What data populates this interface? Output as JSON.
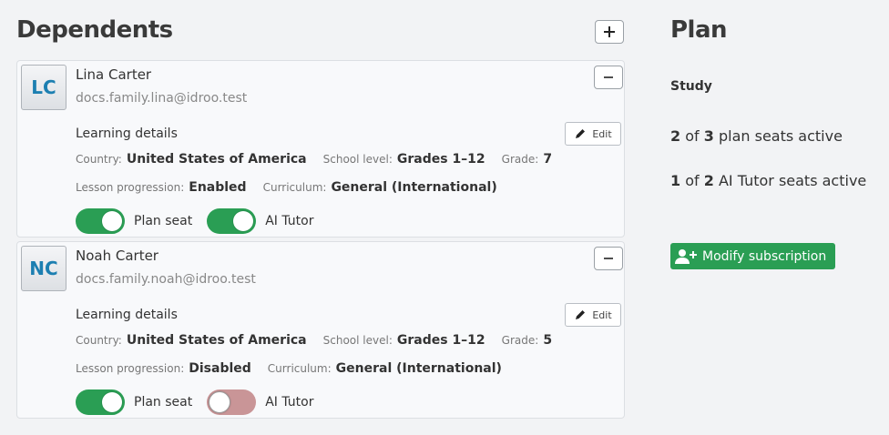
{
  "dependents": {
    "title": "Dependents",
    "cards": [
      {
        "initials": "LC",
        "name": "Lina Carter",
        "email": "docs.family.lina@idroo.test",
        "section_title": "Learning details",
        "edit_label": "Edit",
        "country_label": "Country:",
        "country": "United States of America",
        "school_level_label": "School level:",
        "school_level": "Grades 1–12",
        "grade_label": "Grade:",
        "grade": "7",
        "progression_label": "Lesson progression:",
        "progression": "Enabled",
        "curriculum_label": "Curriculum:",
        "curriculum": "General (International)",
        "plan_seat_label": "Plan seat",
        "plan_seat_on": true,
        "ai_tutor_label": "AI Tutor",
        "ai_tutor_on": true
      },
      {
        "initials": "NC",
        "name": "Noah Carter",
        "email": "docs.family.noah@idroo.test",
        "section_title": "Learning details",
        "edit_label": "Edit",
        "country_label": "Country:",
        "country": "United States of America",
        "school_level_label": "School level:",
        "school_level": "Grades 1–12",
        "grade_label": "Grade:",
        "grade": "5",
        "progression_label": "Lesson progression:",
        "progression": "Disabled",
        "curriculum_label": "Curriculum:",
        "curriculum": "General (International)",
        "plan_seat_label": "Plan seat",
        "plan_seat_on": true,
        "ai_tutor_label": "AI Tutor",
        "ai_tutor_on": false
      }
    ]
  },
  "plan": {
    "title": "Plan",
    "name": "Study",
    "seats_active": "2",
    "seats_of": "of",
    "seats_total": "3",
    "seats_text": "plan seats active",
    "ai_active": "1",
    "ai_of": "of",
    "ai_total": "2",
    "ai_text": "AI Tutor seats active",
    "modify_label": "Modify subscription"
  },
  "colors": {
    "accent_green": "#2a9e54",
    "toggle_off": "#c99597",
    "avatar_text": "#1c7fb1"
  }
}
